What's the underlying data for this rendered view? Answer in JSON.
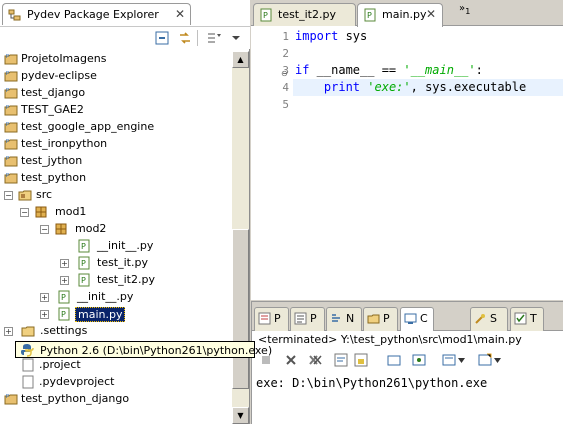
{
  "explorer": {
    "title": "Pydev Package Explorer",
    "tree": [
      {
        "label": "ProjetoImagens"
      },
      {
        "label": "pydev-eclipse"
      },
      {
        "label": "test_django"
      },
      {
        "label": "TEST_GAE2"
      },
      {
        "label": "test_google_app_engine"
      },
      {
        "label": "test_ironpython"
      },
      {
        "label": "test_jython"
      },
      {
        "label": "test_python"
      },
      {
        "label": "src"
      },
      {
        "label": "mod1"
      },
      {
        "label": "mod2"
      },
      {
        "label": "__init__.py"
      },
      {
        "label": "test_it.py"
      },
      {
        "label": "test_it2.py"
      },
      {
        "label": "__init__.py"
      },
      {
        "label": "main.py"
      },
      {
        "label": ".settings"
      },
      {
        "label": ".project"
      },
      {
        "label": ".pydevproject"
      },
      {
        "label": "test_python_django"
      }
    ],
    "tooltip": "Python 2.6  (D:\\bin\\Python261\\python.exe)"
  },
  "editor": {
    "tabs": [
      {
        "label": "test_it2.py",
        "active": false
      },
      {
        "label": "main.py",
        "active": true
      }
    ],
    "more_tabs": "1",
    "line_numbers": [
      "1",
      "2",
      "3",
      "4",
      "5"
    ],
    "code": {
      "line1_kw": "import",
      "line1_rest": " sys",
      "line3_kw": "if",
      "line3_mid": " __name__ == ",
      "line3_str": "'__main__'",
      "line3_end": ":",
      "line4_kw": "print",
      "line4_str": "'exe:'",
      "line4_rest": ", sys.executable"
    }
  },
  "console": {
    "tabs": [
      {
        "label": "P"
      },
      {
        "label": "P"
      },
      {
        "label": "N"
      },
      {
        "label": "P"
      },
      {
        "label": "C"
      },
      {
        "label": "S"
      },
      {
        "label": "T"
      }
    ],
    "title": "<terminated> Y:\\test_python\\src\\mod1\\main.py",
    "output": "exe: D:\\bin\\Python261\\python.exe"
  },
  "colors": {
    "selection": "#0a246a",
    "keyword": "#0000ff",
    "string": "#00aa00",
    "current_line": "#e8f2fe",
    "tooltip_bg": "#ffffe1"
  }
}
